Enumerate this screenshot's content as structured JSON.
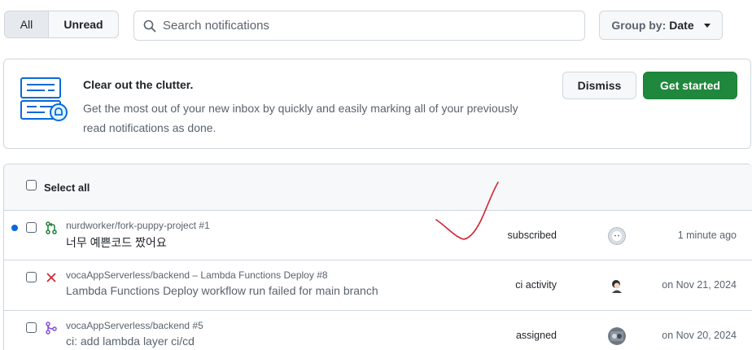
{
  "toolbar": {
    "filter_all": "All",
    "filter_unread": "Unread",
    "search_placeholder": "Search notifications",
    "group_by_label": "Group by:",
    "group_by_value": "Date"
  },
  "banner": {
    "title": "Clear out the clutter.",
    "text": "Get the most out of your new inbox by quickly and easily marking all of your previously read notifications as done.",
    "dismiss_label": "Dismiss",
    "get_started_label": "Get started"
  },
  "list": {
    "select_all_label": "Select all",
    "rows": [
      {
        "repo": "nurdworker/fork-puppy-project",
        "number": "#1",
        "subject": "너무 예쁜코드 짰어요",
        "reason": "subscribed",
        "time": "1 minute ago",
        "type_icon": "pull-request-icon",
        "unread": true
      },
      {
        "repo": "vocaAppServerless/backend – Lambda Functions Deploy",
        "number": "#8",
        "subject": "Lambda Functions Deploy workflow run failed for main branch",
        "reason": "ci activity",
        "time": "on Nov 21, 2024",
        "type_icon": "x-icon",
        "unread": false
      },
      {
        "repo": "vocaAppServerless/backend",
        "number": "#5",
        "subject": "ci: add lambda layer ci/cd",
        "reason": "assigned",
        "time": "on Nov 20, 2024",
        "type_icon": "merged-pr-icon",
        "unread": false
      }
    ]
  },
  "colors": {
    "unread_dot": "#0969da",
    "primary_button": "#1f883d",
    "annotation": "#d1242f"
  }
}
